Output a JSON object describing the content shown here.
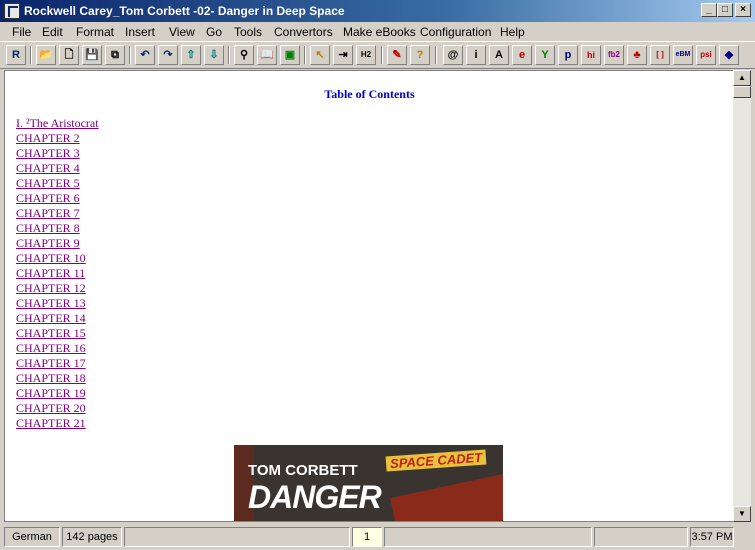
{
  "window": {
    "title": "Rockwell Carey_Tom Corbett -02- Danger in Deep Space",
    "controls": [
      "_",
      "□",
      "×"
    ]
  },
  "menu": [
    "File",
    "Edit",
    "Format",
    "Insert",
    "View",
    "Go",
    "Tools",
    "Convertors",
    "Make eBooks",
    "Configuration",
    "Help"
  ],
  "toolbar": {
    "buttons": [
      {
        "name": "reader-icon",
        "glyph": "R"
      },
      {
        "name": "open-icon",
        "glyph": "📂"
      },
      {
        "name": "new-icon",
        "glyph": "🗋"
      },
      {
        "name": "save-icon",
        "glyph": "💾"
      },
      {
        "name": "save-all-icon",
        "glyph": "⧉"
      },
      {
        "name": "undo-icon",
        "glyph": "↶"
      },
      {
        "name": "redo-icon",
        "glyph": "↷"
      },
      {
        "name": "move-up-icon",
        "glyph": "⇧"
      },
      {
        "name": "move-down-icon",
        "glyph": "⇩"
      },
      {
        "name": "find-icon",
        "glyph": "⚲"
      },
      {
        "name": "book-icon",
        "glyph": "📖"
      },
      {
        "name": "image-icon",
        "glyph": "▣"
      },
      {
        "name": "cursor-icon",
        "glyph": "↖"
      },
      {
        "name": "insert-icon",
        "glyph": "⇥"
      },
      {
        "name": "h2-icon",
        "glyph": "H2"
      },
      {
        "name": "pen-icon",
        "glyph": "✎"
      },
      {
        "name": "help-icon",
        "glyph": "?"
      },
      {
        "name": "at-icon",
        "glyph": "@"
      },
      {
        "name": "info-icon",
        "glyph": "i"
      },
      {
        "name": "font-icon",
        "glyph": "A"
      },
      {
        "name": "e-icon",
        "glyph": "e"
      },
      {
        "name": "y-icon",
        "glyph": "Y"
      },
      {
        "name": "palm-icon",
        "glyph": "p"
      },
      {
        "name": "hi-icon",
        "glyph": "hi"
      },
      {
        "name": "fb2-icon",
        "glyph": "fb2"
      },
      {
        "name": "red-icon",
        "glyph": "♣"
      },
      {
        "name": "bracket-icon",
        "glyph": "[ ]"
      },
      {
        "name": "ebm-icon",
        "glyph": "eBM"
      },
      {
        "name": "psi-icon",
        "glyph": "psi"
      },
      {
        "name": "diamond-icon",
        "glyph": "◆"
      }
    ]
  },
  "document": {
    "toc_title": "Table of Contents",
    "chapters": [
      "I. ²The Aristocrat",
      "CHAPTER 2",
      "CHAPTER 3",
      "CHAPTER 4",
      "CHAPTER 5",
      "CHAPTER 6",
      "CHAPTER 7",
      "CHAPTER 8",
      "CHAPTER 9",
      "CHAPTER 10",
      "CHAPTER 11",
      "CHAPTER 12",
      "CHAPTER 13",
      "CHAPTER 14",
      "CHAPTER 15",
      "CHAPTER 16",
      "CHAPTER 17",
      "CHAPTER 18",
      "CHAPTER 19",
      "CHAPTER 20",
      "CHAPTER 21"
    ],
    "cover": {
      "author": "TOM CORBETT",
      "badge": "SPACE CADET",
      "title": "DANGER"
    }
  },
  "status": {
    "language": "German",
    "pages": "142 pages",
    "current_page": "1",
    "time": "3:57 PM"
  },
  "colors": {
    "title_gradient_start": "#0a246a",
    "heading": "#0000cc",
    "link_visited": "#800080"
  }
}
